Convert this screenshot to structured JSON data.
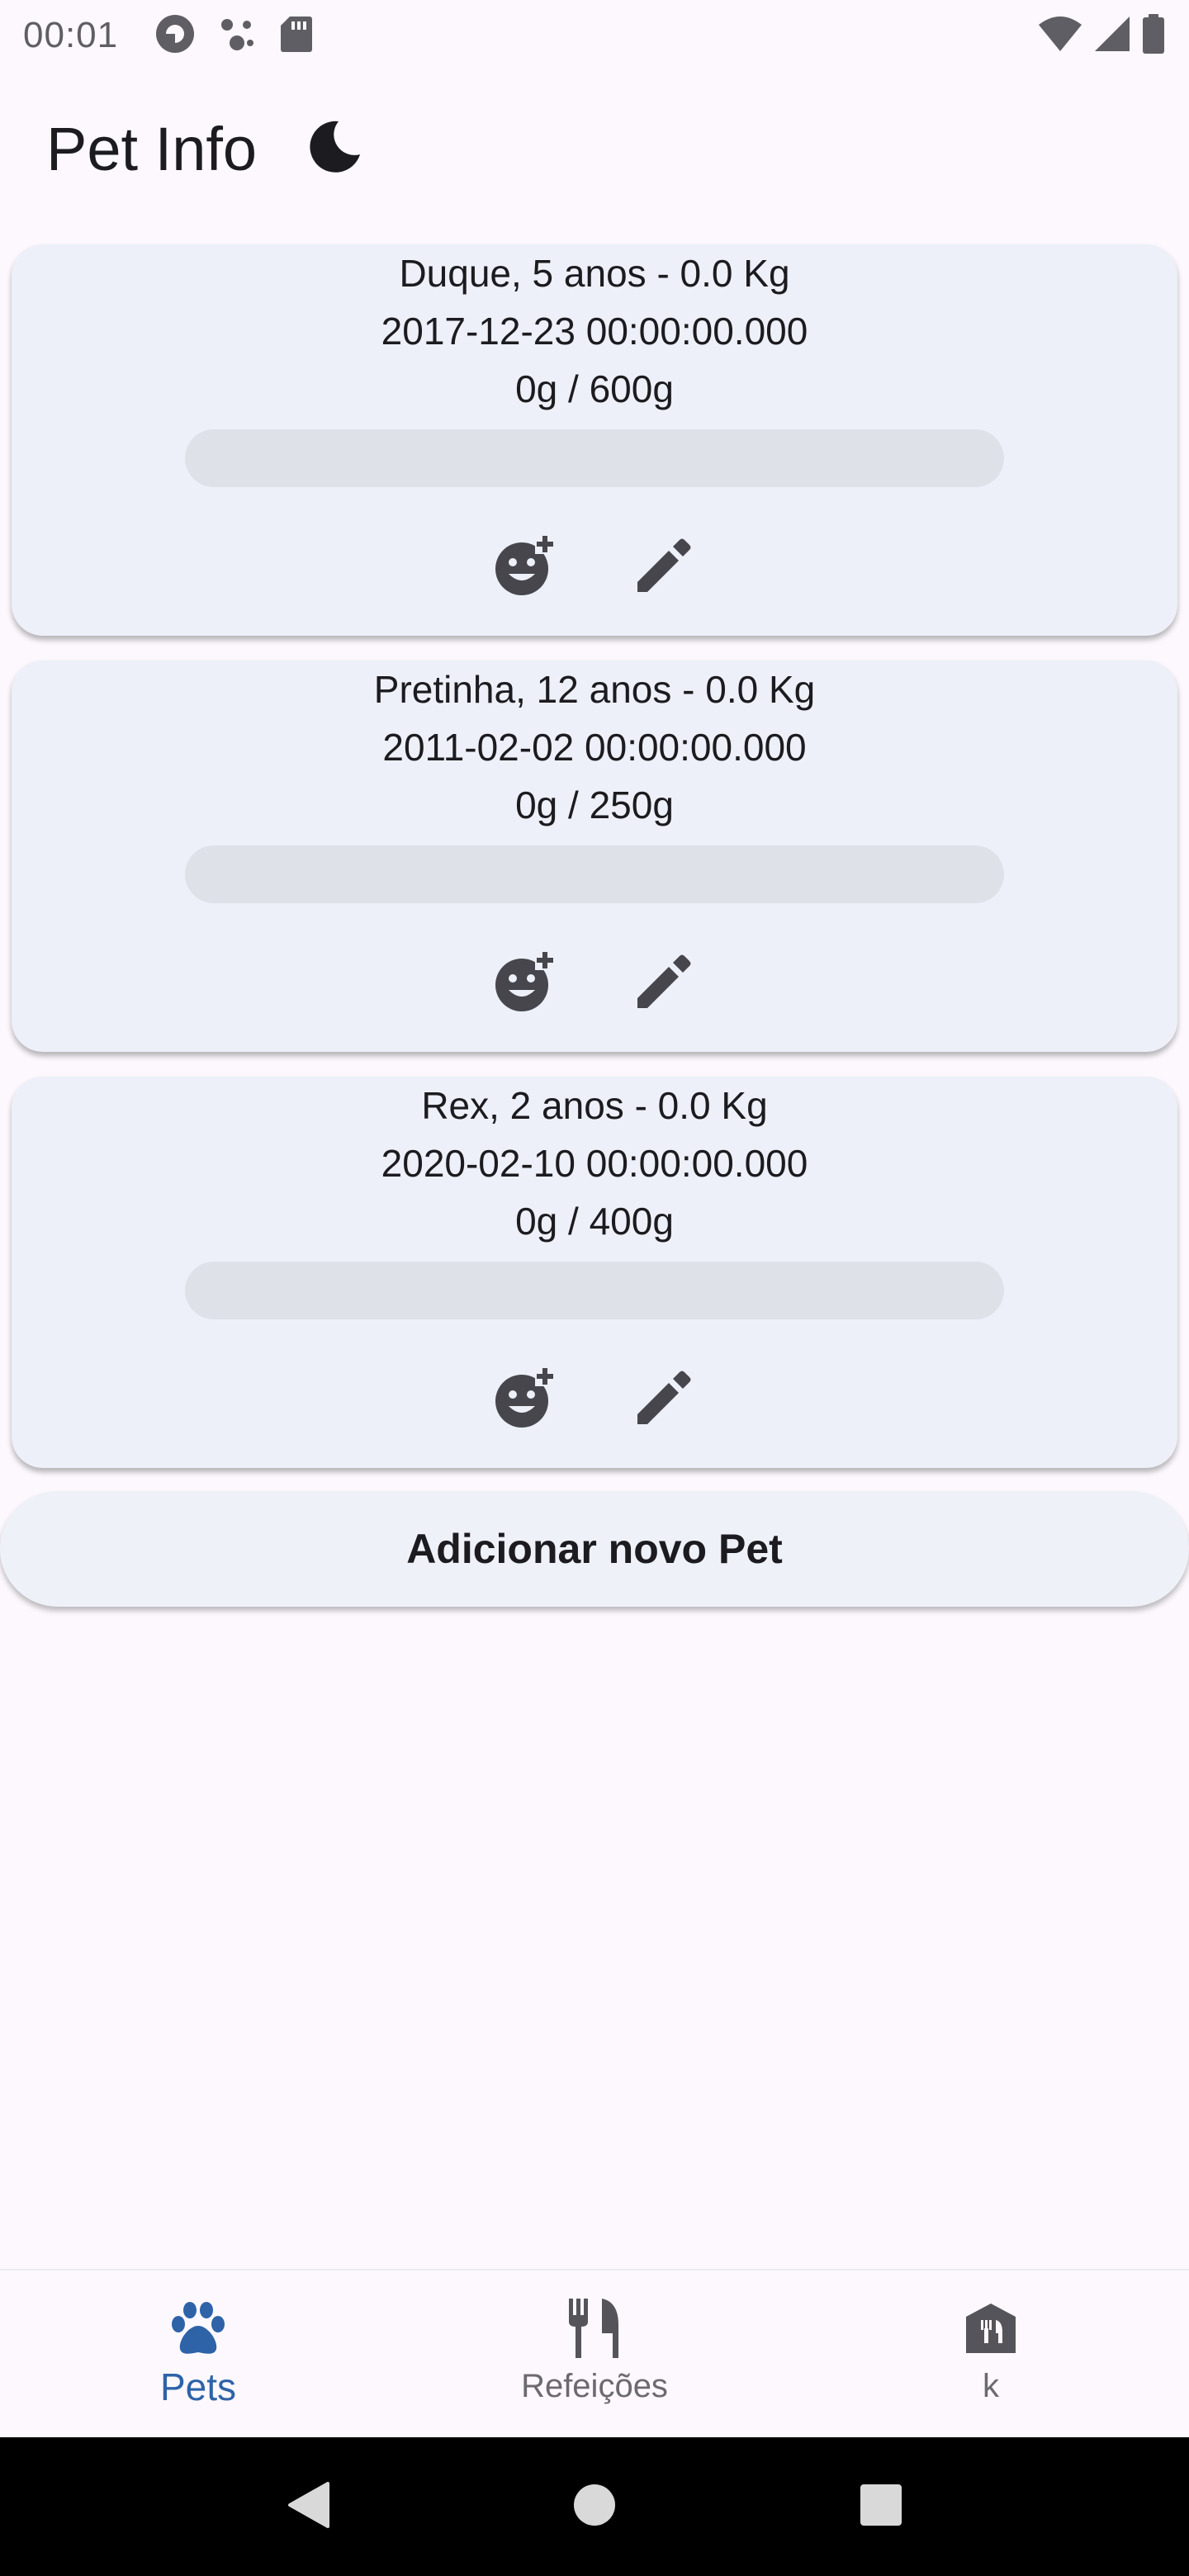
{
  "status_bar": {
    "time": "00:01",
    "icons": [
      "pocket-casts-icon",
      "dots-app-icon",
      "sd-card-icon",
      "wifi-icon",
      "signal-icon",
      "battery-icon"
    ]
  },
  "header": {
    "title": "Pet Info",
    "theme_icon": "moon-icon"
  },
  "pets": [
    {
      "title": "Duque, 5 anos - 0.0 Kg",
      "date": "2017-12-23 00:00:00.000",
      "food": "0g / 600g",
      "progress": 0
    },
    {
      "title": "Pretinha, 12 anos - 0.0 Kg",
      "date": "2011-02-02 00:00:00.000",
      "food": "0g / 250g",
      "progress": 0
    },
    {
      "title": "Rex, 2 anos - 0.0 Kg",
      "date": "2020-02-10 00:00:00.000",
      "food": "0g / 400g",
      "progress": 0
    }
  ],
  "card_actions": {
    "feed_icon": "add-reaction-icon",
    "edit_icon": "edit-pencil-icon"
  },
  "add_button": {
    "label": "Adicionar novo Pet"
  },
  "bottom_nav": {
    "items": [
      {
        "label": "Pets",
        "icon": "paw-icon",
        "active": true
      },
      {
        "label": "Refeições",
        "icon": "restaurant-icon",
        "active": false
      },
      {
        "label": "k",
        "icon": "house-food-icon",
        "active": false
      }
    ]
  },
  "colors": {
    "accent": "#2e63a8",
    "card": "#edf0f8",
    "track": "#dfe1e9",
    "icon": "#46464c"
  }
}
